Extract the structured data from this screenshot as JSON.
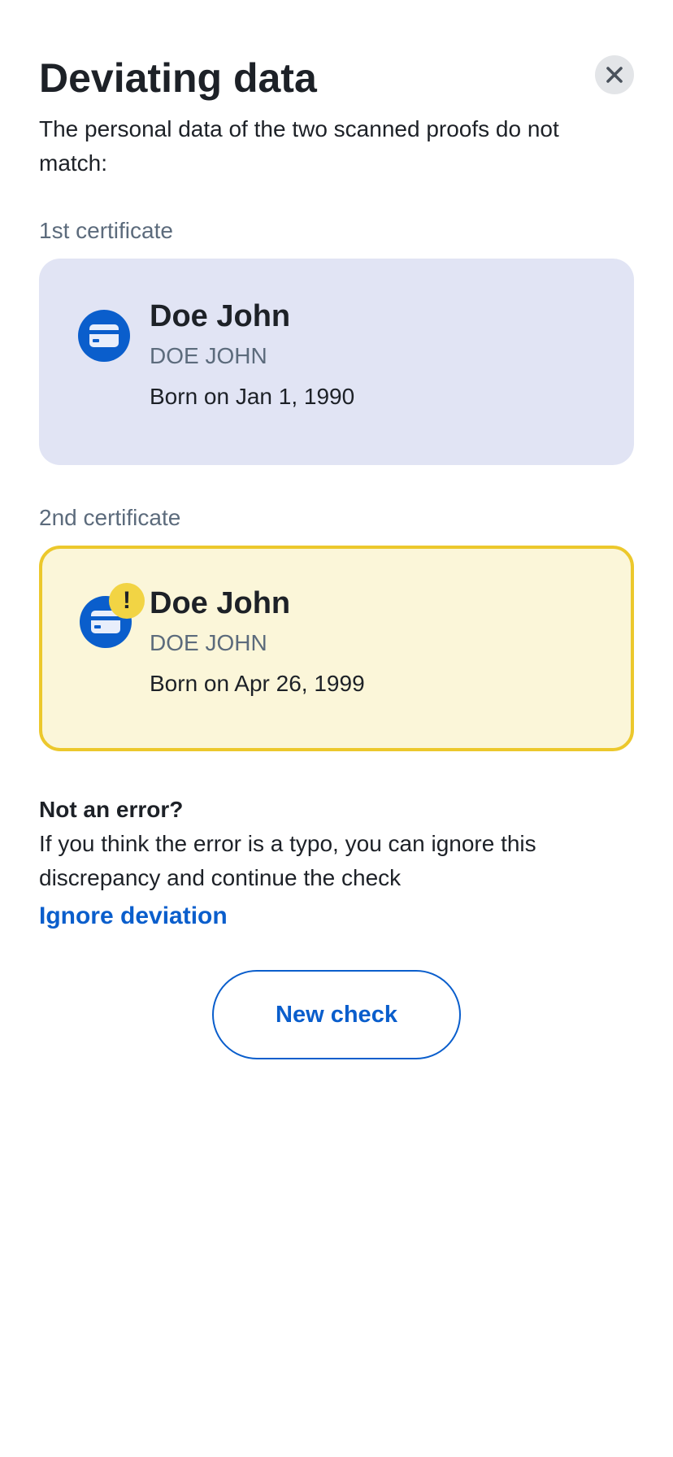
{
  "header": {
    "title": "Deviating data",
    "close_icon": "close-icon"
  },
  "intro": "The personal data of the two scanned proofs do not match:",
  "certificates": [
    {
      "label": "1st certificate",
      "name": "Doe John",
      "name_caps": "DOE JOHN",
      "born": "Born on Jan 1, 1990",
      "icon": "id-card-icon",
      "status": "normal",
      "background": "#e1e4f4"
    },
    {
      "label": "2nd certificate",
      "name": "Doe John",
      "name_caps": "DOE JOHN",
      "born": "Born on Apr 26, 1999",
      "icon": "id-card-icon",
      "badge": "!",
      "status": "warning",
      "background": "#fbf6d9",
      "border": "#ecc82c"
    }
  ],
  "hint": {
    "title": "Not an error?",
    "text": "If you think the error is a typo, you can ignore this discrepancy and continue the check",
    "link": "Ignore deviation"
  },
  "actions": {
    "new_check": "New check"
  },
  "colors": {
    "accent": "#0a5ecc",
    "warning": "#f2d444",
    "text": "#1d2127",
    "muted": "#5c6b7c"
  }
}
